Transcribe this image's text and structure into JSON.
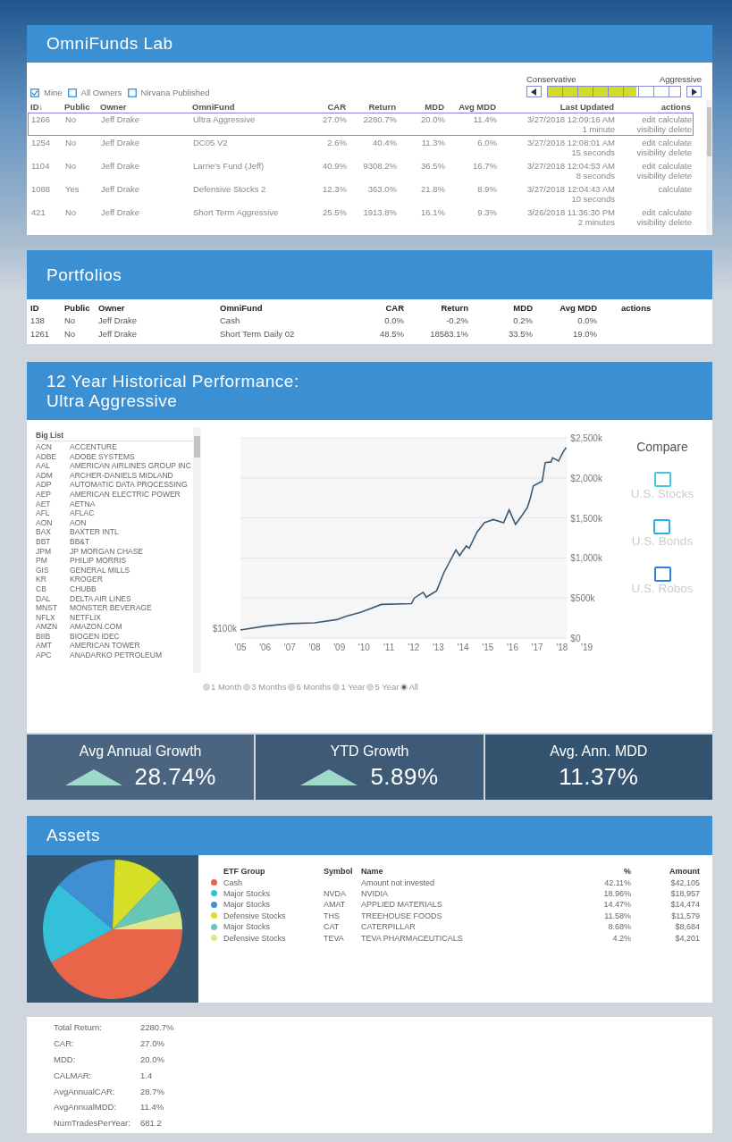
{
  "lab": {
    "title": "OmniFunds Lab",
    "filters": [
      {
        "label": "Mine",
        "checked": true
      },
      {
        "label": "All Owners",
        "checked": false
      },
      {
        "label": "Nirvana Published",
        "checked": false
      }
    ],
    "risk": {
      "left_label": "Conservative",
      "right_label": "Aggressive",
      "level": 0.667
    },
    "columns": [
      "ID↓",
      "Public",
      "Owner",
      "OmniFund",
      "CAR",
      "Return",
      "MDD",
      "Avg MDD",
      "Last Updated",
      "actions"
    ],
    "rows": [
      {
        "selected": true,
        "cells": [
          "1266",
          "No",
          "Jeff Drake",
          "Ultra Aggressive",
          "27.0%",
          "2280.7%",
          "20.0%",
          "11.4%"
        ],
        "updated": "3/27/2018 12:09:16 AM",
        "ago": "1 minute",
        "actions": [
          "edit",
          "calculate",
          "visibility",
          "delete"
        ]
      },
      {
        "selected": false,
        "cells": [
          "1254",
          "No",
          "Jeff Drake",
          "DC05 V2",
          "2.6%",
          "40.4%",
          "11.3%",
          "6.0%"
        ],
        "updated": "3/27/2018 12:08:01 AM",
        "ago": "15 seconds",
        "actions": [
          "edit",
          "calculate",
          "visibility",
          "delete"
        ]
      },
      {
        "selected": false,
        "cells": [
          "1104",
          "No",
          "Jeff Drake",
          "Larrie's Fund (Jeff)",
          "40.9%",
          "9308.2%",
          "36.5%",
          "16.7%"
        ],
        "updated": "3/27/2018 12:04:53 AM",
        "ago": "8 seconds",
        "actions": [
          "edit",
          "calculate",
          "visibility",
          "delete"
        ]
      },
      {
        "selected": false,
        "cells": [
          "1088",
          "Yes",
          "Jeff Drake",
          "Defensive Stocks 2",
          "12.3%",
          "363.0%",
          "21.8%",
          "8.9%"
        ],
        "updated": "3/27/2018 12:04:43 AM",
        "ago": "10 seconds",
        "actions": [
          "calculate"
        ]
      },
      {
        "selected": false,
        "cells": [
          "421",
          "No",
          "Jeff Drake",
          "Short Term Aggressive",
          "25.5%",
          "1913.8%",
          "16.1%",
          "9.3%"
        ],
        "updated": "3/26/2018 11:36:30 PM",
        "ago": "2 minutes",
        "actions": [
          "edit",
          "calculate",
          "visibility",
          "delete"
        ]
      }
    ]
  },
  "portfolios": {
    "title": "Portfolios",
    "columns": [
      "ID",
      "Public",
      "Owner",
      "OmniFund",
      "CAR",
      "Return",
      "MDD",
      "Avg MDD",
      "actions"
    ],
    "rows": [
      [
        "138",
        "No",
        "Jeff Drake",
        "Cash",
        "0.0%",
        "-0.2%",
        "0.2%",
        "0.0%"
      ],
      [
        "1261",
        "No",
        "Jeff Drake",
        "Short Term Daily 02",
        "48.5%",
        "18583.1%",
        "33.5%",
        "19.0%"
      ]
    ]
  },
  "performance": {
    "title": "12 Year Historical Performance:",
    "subtitle": "Ultra Aggressive",
    "big_list": {
      "title": "Big List",
      "items": [
        {
          "symbol": "ACN",
          "name": "ACCENTURE"
        },
        {
          "symbol": "ADBE",
          "name": "ADOBE SYSTEMS"
        },
        {
          "symbol": "AAL",
          "name": "AMERICAN AIRLINES GROUP INC"
        },
        {
          "symbol": "ADM",
          "name": "ARCHER-DANIELS MIDLAND"
        },
        {
          "symbol": "ADP",
          "name": "AUTOMATIC DATA PROCESSING"
        },
        {
          "symbol": "AEP",
          "name": "AMERICAN ELECTRIC POWER"
        },
        {
          "symbol": "AET",
          "name": "AETNA"
        },
        {
          "symbol": "AFL",
          "name": "AFLAC"
        },
        {
          "symbol": "AON",
          "name": "AON"
        },
        {
          "symbol": "BAX",
          "name": "BAXTER INTL"
        },
        {
          "symbol": "BBT",
          "name": "BB&T"
        },
        {
          "symbol": "JPM",
          "name": "JP MORGAN CHASE"
        },
        {
          "symbol": "PM",
          "name": "PHILIP MORRIS"
        },
        {
          "symbol": "GIS",
          "name": "GENERAL MILLS"
        },
        {
          "symbol": "KR",
          "name": "KROGER"
        },
        {
          "symbol": "CB",
          "name": "CHUBB"
        },
        {
          "symbol": "DAL",
          "name": "DELTA AIR LINES"
        },
        {
          "symbol": "MNST",
          "name": "MONSTER BEVERAGE"
        },
        {
          "symbol": "NFLX",
          "name": "NETFLIX"
        },
        {
          "symbol": "AMZN",
          "name": "AMAZON.COM"
        },
        {
          "symbol": "BIIB",
          "name": "BIOGEN IDEC"
        },
        {
          "symbol": "AMT",
          "name": "AMERICAN TOWER"
        },
        {
          "symbol": "APC",
          "name": "ANADARKO PETROLEUM"
        }
      ]
    },
    "chart_data": {
      "type": "line",
      "xlim": [
        2005,
        2019
      ],
      "ylim": [
        0,
        2500
      ],
      "grid": true,
      "x": [
        2005,
        2006,
        2007,
        2008,
        2008.9,
        2009.26,
        2009.86,
        2010.7,
        2011.91,
        2012.03,
        2012.39,
        2012.51,
        2012.93,
        2013.23,
        2013.71,
        2013.86,
        2014.13,
        2014.25,
        2014.56,
        2014.86,
        2015.22,
        2015.64,
        2015.86,
        2016.12,
        2016.36,
        2016.6,
        2016.72,
        2016.84,
        2017.2,
        2017.32,
        2017.56,
        2017.62,
        2017.86,
        2018.04,
        2018.17
      ],
      "series": [
        {
          "color": "#3b5a78",
          "values": [
            100,
            150,
            180,
            190,
            230,
            270,
            320,
            420,
            430,
            500,
            570,
            510,
            590,
            820,
            1100,
            1030,
            1150,
            1120,
            1320,
            1440,
            1480,
            1440,
            1600,
            1420,
            1520,
            1630,
            1750,
            1900,
            1960,
            2190,
            2200,
            2250,
            2210,
            2320,
            2380
          ]
        }
      ],
      "xticks": [
        {
          "value": 2005,
          "label": "'05"
        },
        {
          "value": 2006,
          "label": "'06"
        },
        {
          "value": 2007,
          "label": "'07"
        },
        {
          "value": 2008,
          "label": "'08"
        },
        {
          "value": 2009,
          "label": "'09"
        },
        {
          "value": 2010,
          "label": "'10"
        },
        {
          "value": 2011,
          "label": "'11"
        },
        {
          "value": 2012,
          "label": "'12"
        },
        {
          "value": 2013,
          "label": "'13"
        },
        {
          "value": 2014,
          "label": "'14"
        },
        {
          "value": 2015,
          "label": "'15"
        },
        {
          "value": 2016,
          "label": "'16"
        },
        {
          "value": 2017,
          "label": "'17"
        },
        {
          "value": 2018,
          "label": "'18"
        },
        {
          "value": 2019,
          "label": "'19"
        }
      ],
      "yticks": [
        {
          "value": 0,
          "label": "$0"
        },
        {
          "value": 500,
          "label": "$500k"
        },
        {
          "value": 1000,
          "label": "$1,000k"
        },
        {
          "value": 1500,
          "label": "$1,500k"
        },
        {
          "value": 2000,
          "label": "$2,000k"
        },
        {
          "value": 2500,
          "label": "$2,500k"
        }
      ],
      "annotations": [
        {
          "x": 2005,
          "y": 100,
          "text": "$100k"
        }
      ]
    },
    "ranges": [
      {
        "label": "1 Month",
        "selected": false
      },
      {
        "label": "3 Months",
        "selected": false
      },
      {
        "label": "6 Months",
        "selected": false
      },
      {
        "label": "1 Year",
        "selected": false
      },
      {
        "label": "5 Year",
        "selected": false
      },
      {
        "label": "All",
        "selected": true
      }
    ],
    "compare": {
      "title": "Compare",
      "items": [
        {
          "label": "U.S. Stocks",
          "checked": false,
          "color": "#3fc6e2"
        },
        {
          "label": "U.S. Bonds",
          "checked": false,
          "color": "#25aef0"
        },
        {
          "label": "U.S. Robos",
          "checked": false,
          "color": "#2f7fe0"
        }
      ]
    },
    "tiles": [
      {
        "label": "Avg Annual Growth",
        "value": "28.74%",
        "kind": "up"
      },
      {
        "label": "YTD Growth",
        "value": "5.89%",
        "kind": "up"
      },
      {
        "label": "Avg. Ann. MDD",
        "value": "11.37%",
        "kind": "plain"
      }
    ]
  },
  "assets": {
    "title": "Assets",
    "chart_data": {
      "type": "pie",
      "values": [
        42.11,
        18.96,
        14.47,
        11.58,
        8.68,
        4.2
      ],
      "colors": [
        "#e8654a",
        "#35c0da",
        "#3f8fd2",
        "#d6df25",
        "#67c6b6",
        "#dfe78a"
      ]
    },
    "columns": [
      "ETF Group",
      "Symbol",
      "Name",
      "%",
      "Amount"
    ],
    "rows": [
      {
        "color": "#e8654a",
        "cells": [
          "Cash",
          "",
          "Amount not invested",
          "42.11%",
          "$42,105"
        ]
      },
      {
        "color": "#35c0da",
        "cells": [
          "Major Stocks",
          "NVDA",
          "NVIDIA",
          "18.96%",
          "$18,957"
        ]
      },
      {
        "color": "#3f8fd2",
        "cells": [
          "Major Stocks",
          "AMAT",
          "APPLIED MATERIALS",
          "14.47%",
          "$14,474"
        ]
      },
      {
        "color": "#d6df25",
        "cells": [
          "Defensive Stocks",
          "THS",
          "TREEHOUSE FOODS",
          "11.58%",
          "$11,579"
        ]
      },
      {
        "color": "#67c6b6",
        "cells": [
          "Major Stocks",
          "CAT",
          "CATERPILLAR",
          "8.68%",
          "$8,684"
        ]
      },
      {
        "color": "#dfe78a",
        "cells": [
          "Defensive Stocks",
          "TEVA",
          "TEVA PHARMACEUTICALS",
          "4.2%",
          "$4,201"
        ]
      }
    ]
  },
  "stats": [
    {
      "label": "Total Return:",
      "value": "2280.7%"
    },
    {
      "label": "CAR:",
      "value": "27.0%"
    },
    {
      "label": "MDD:",
      "value": "20.0%"
    },
    {
      "label": "CALMAR:",
      "value": "1.4"
    },
    {
      "label": "AvgAnnualCAR:",
      "value": "28.7%"
    },
    {
      "label": "AvgAnnualMDD:",
      "value": "11.4%"
    },
    {
      "label": "NumTradesPerYear:",
      "value": "681.2"
    }
  ]
}
